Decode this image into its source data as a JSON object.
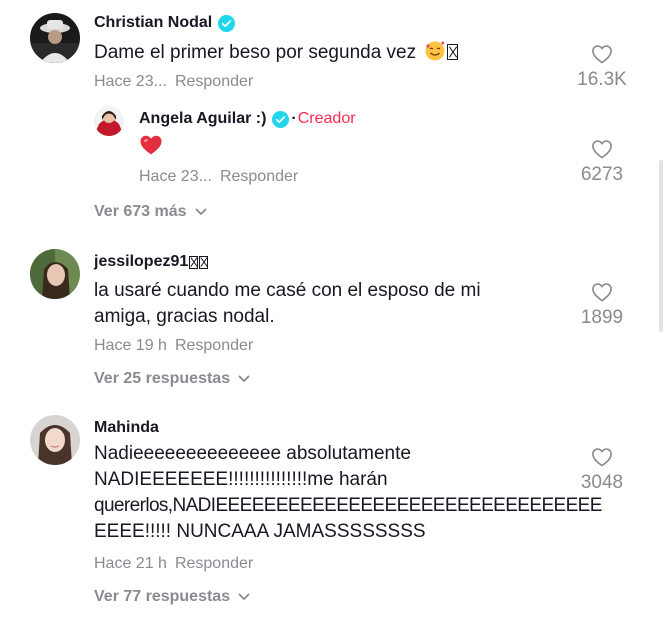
{
  "comments": [
    {
      "author": "Christian Nodal",
      "verified": true,
      "text": "Dame el primer beso por segunda vez",
      "time": "Hace 23...",
      "reply_label": "Responder",
      "likes": "16.3K",
      "replies": [
        {
          "author": "Angela Aguilar :)",
          "verified": true,
          "badge": "Creador",
          "text_emoji": "red-heart",
          "time": "Hace 23...",
          "reply_label": "Responder",
          "likes": "6273"
        }
      ],
      "more_label": "Ver 673 más"
    },
    {
      "author": "jessilopez91",
      "text_line1": "la usaré cuando me casé con el esposo de mi",
      "text_line2": "amiga, gracias nodal.",
      "time": "Hace 19 h",
      "reply_label": "Responder",
      "likes": "1899",
      "more_label": "Ver 25 respuestas"
    },
    {
      "author": "Mahinda",
      "text_line1": "Nadieeeeeeeeeeeeee absolutamente",
      "text_line2": "NADIEEEEEEE!!!!!!!!!!!!!!!me harán",
      "text_line3": "quererlos,NADIEEEEEEEEEEEEEEEEEEEEEEEEEEEEEEEE",
      "text_line4": "EEEE!!!!! NUNCAAA JAMASSSSSSSS",
      "time": "Hace 21 h",
      "reply_label": "Responder",
      "likes": "3048",
      "more_label": "Ver 77 respuestas"
    }
  ],
  "colors": {
    "text": "#161823",
    "muted": "#8a8b91",
    "accent": "#fe2c55",
    "verified": "#20d5ec"
  },
  "icons": [
    "verified-badge-icon",
    "heart-outline-icon",
    "chevron-down-icon",
    "smiling-face-with-hearts-emoji",
    "red-heart-emoji"
  ]
}
